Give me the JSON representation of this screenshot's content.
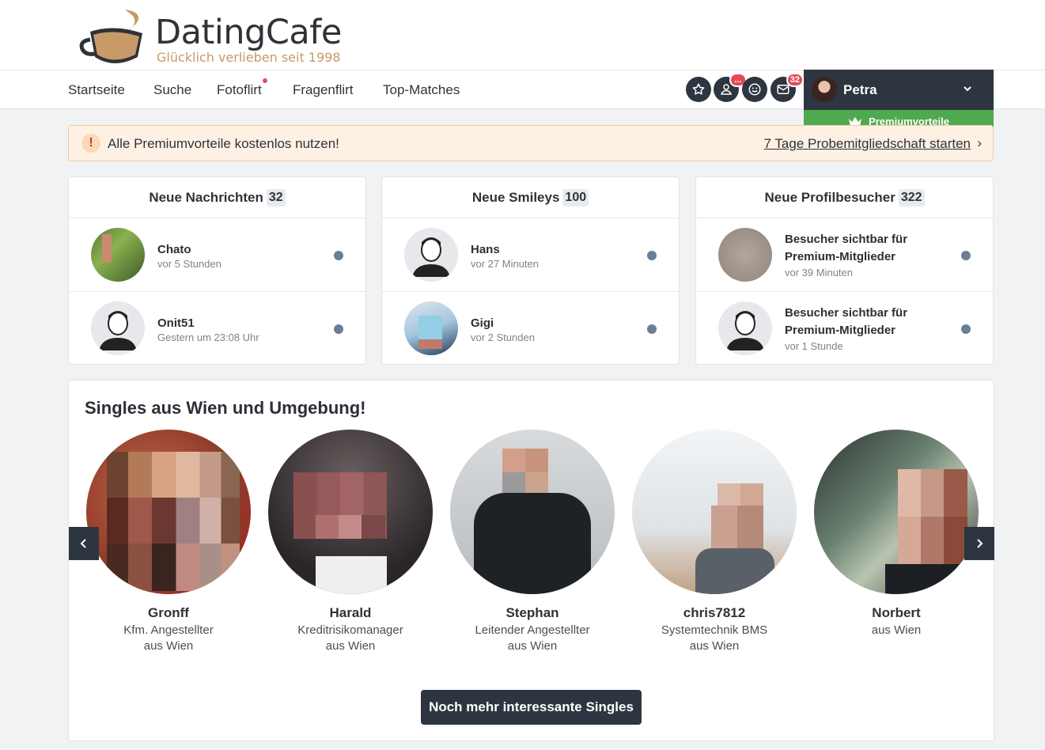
{
  "brand": {
    "name": "DatingCafe",
    "slogan": "Glücklich verlieben seit 1998"
  },
  "nav": {
    "items": [
      {
        "label": "Startseite"
      },
      {
        "label": "Suche"
      },
      {
        "label": "Fotoflirt"
      },
      {
        "label": "Fragenflirt"
      },
      {
        "label": "Top-Matches"
      }
    ]
  },
  "toolbar": {
    "icons": [
      "star-icon",
      "profile-visitors-icon",
      "smiley-icon",
      "mail-icon"
    ],
    "visitors_badge": "...",
    "mail_badge": "32"
  },
  "user": {
    "name": "Petra",
    "premium_label": "Premiumvorteile"
  },
  "promo": {
    "text": "Alle Premiumvorteile kostenlos nutzen!",
    "link": "7 Tage Probemitgliedschaft starten",
    "arrow": "›"
  },
  "cards": {
    "messages": {
      "title": "Neue Nachrichten",
      "count": "32",
      "rows": [
        {
          "name": "Chato",
          "time": "vor 5 Stunden"
        },
        {
          "name": "Onit51",
          "time": "Gestern um 23:08 Uhr"
        }
      ]
    },
    "smileys": {
      "title": "Neue Smileys",
      "count": "100",
      "rows": [
        {
          "name": "Hans",
          "time": "vor 27 Minuten"
        },
        {
          "name": "Gigi",
          "time": "vor 2 Stunden"
        }
      ]
    },
    "visitors": {
      "title": "Neue Profilbesucher",
      "count": "322",
      "rows": [
        {
          "name": "Besucher sichtbar für Premium-Mitglieder",
          "time": "vor 39 Minuten"
        },
        {
          "name": "Besucher sichtbar für Premium-Mitglieder",
          "time": "vor 1 Stunde"
        }
      ]
    }
  },
  "singles": {
    "title": "Singles aus Wien und Umgebung!",
    "people": [
      {
        "name": "Gronff",
        "job": "Kfm. Angestellter",
        "location": "aus Wien"
      },
      {
        "name": "Harald",
        "job": "Kreditrisikomanager",
        "location": "aus Wien"
      },
      {
        "name": "Stephan",
        "job": "Leitender Angestellter",
        "location": "aus Wien"
      },
      {
        "name": "chris7812",
        "job": "Systemtechnik BMS",
        "location": "aus Wien"
      },
      {
        "name": "Norbert",
        "job": "aus Wien",
        "location": ""
      }
    ],
    "more_button": "Noch mehr interessante Singles"
  },
  "colors": {
    "dark": "#2d3640",
    "premium_green": "#4fa94f",
    "badge_red": "#e34a57",
    "slogan": "#c89a68"
  }
}
